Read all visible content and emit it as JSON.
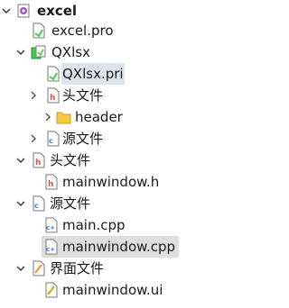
{
  "tree": {
    "root": {
      "label": "excel"
    },
    "items": [
      {
        "label": "excel.pro"
      },
      {
        "label": "QXlsx"
      },
      {
        "label": "QXlsx.pri"
      },
      {
        "label": "头文件"
      },
      {
        "label": "header"
      },
      {
        "label": "源文件"
      },
      {
        "label": "头文件"
      },
      {
        "label": "mainwindow.h"
      },
      {
        "label": "源文件"
      },
      {
        "label": "main.cpp"
      },
      {
        "label": "mainwindow.cpp"
      },
      {
        "label": "界面文件"
      },
      {
        "label": "mainwindow.ui"
      }
    ]
  },
  "colors": {
    "selected_row": "#dedede",
    "folder": "#f5c842",
    "header_file": "#d9534f",
    "qt_green": "#41cd52",
    "cpp_blue": "#3b7dd8",
    "ui_orange": "#e8a23a"
  },
  "icons": {
    "project": "qt-project-icon",
    "pro": "pro-file-icon",
    "pri": "pri-file-icon",
    "folder": "folder-icon",
    "header_folder": "header-folder-icon",
    "source_folder": "source-folder-icon",
    "forms_folder": "forms-folder-icon",
    "h": "h-file-icon",
    "cpp": "cpp-file-icon",
    "ui": "ui-file-icon"
  }
}
